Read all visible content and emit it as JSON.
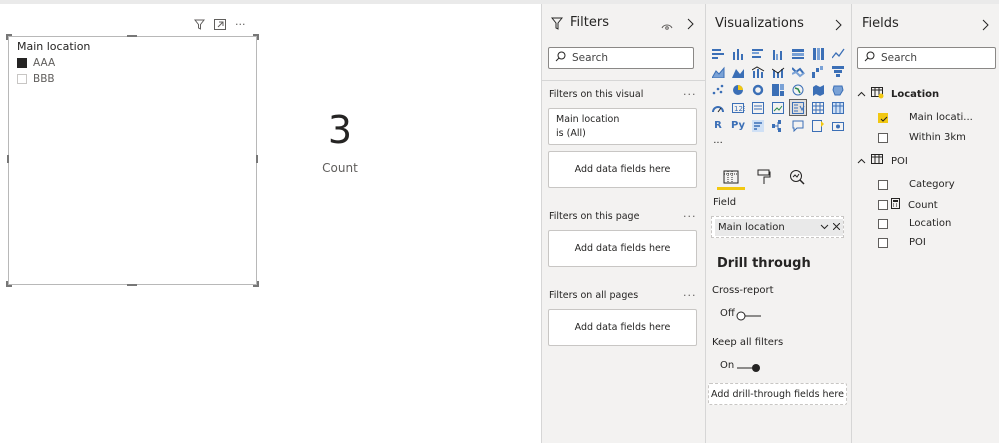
{
  "canvas": {
    "slicer": {
      "title": "Main location",
      "items": [
        {
          "label": "AAA",
          "checked": true
        },
        {
          "label": "BBB",
          "checked": false
        }
      ],
      "header_icons": [
        "filter-icon",
        "focus-mode-icon",
        "more-options-icon"
      ],
      "more_label": "···"
    },
    "card": {
      "value": "3",
      "label": "Count"
    }
  },
  "filters": {
    "title": "Filters",
    "search_placeholder": "Search",
    "on_visual_label": "Filters on this visual",
    "visual_filter": {
      "field": "Main location",
      "condition": "is (All)"
    },
    "add_fields_label": "Add data fields here",
    "on_page_label": "Filters on this page",
    "on_all_pages_label": "Filters on all pages",
    "more_label": "···"
  },
  "visualizations": {
    "title": "Visualizations",
    "more_label": "···",
    "r_label": "R",
    "py_label": "Py",
    "field_label": "Field",
    "field_value": "Main location",
    "drill_through_title": "Drill through",
    "cross_report_label": "Cross-report",
    "cross_report_state": "Off",
    "keep_filters_label": "Keep all filters",
    "keep_filters_state": "On",
    "add_drill_label": "Add drill-through fields here"
  },
  "fields": {
    "title": "Fields",
    "search_placeholder": "Search",
    "tables": [
      {
        "name": "Location",
        "fields": [
          {
            "name": "Main locati...",
            "checked": true
          },
          {
            "name": "Within 3km",
            "checked": false
          }
        ]
      },
      {
        "name": "POI",
        "fields": [
          {
            "name": "Category",
            "checked": false
          },
          {
            "name": "Count",
            "checked": false
          },
          {
            "name": "Location",
            "checked": false
          },
          {
            "name": "POI",
            "checked": false
          }
        ]
      }
    ]
  },
  "colors": {
    "accent": "#f2c811",
    "pane_bg": "#f3f2f1",
    "text": "#252423"
  }
}
